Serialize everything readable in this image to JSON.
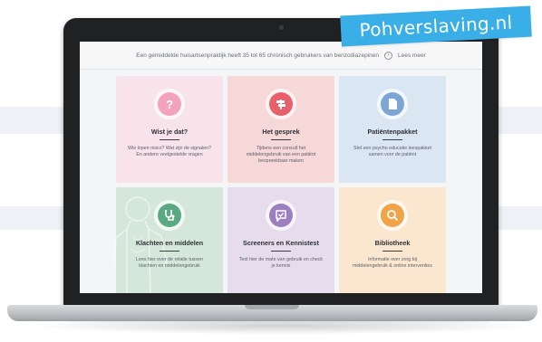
{
  "watermark": {
    "text": "Pohverslaving.nl"
  },
  "topbar": {
    "message": "Een gemiddelde huisartsenpraktijk heeft 35 tot 65 chronisch gebruikers van benzodiazepinen",
    "info_icon": "info-icon",
    "link_label": "Lees meer"
  },
  "cards": [
    {
      "title": "Wist je dat?",
      "description": "Wie lopen risico? Wat zijn de signalen? En andere veelgestelde vragen",
      "icon": "question-icon",
      "color": "#f4a3bd"
    },
    {
      "title": "Het gesprek",
      "description": "Tijdens een consult het middelengebruik van een patiënt bespreekbaar maken",
      "icon": "signpost-icon",
      "color": "#e8606a"
    },
    {
      "title": "Patiëntenpakket",
      "description": "Stel een psycho educatie leespakket samen voor de patiënt",
      "icon": "document-icon",
      "color": "#7ca6d6"
    },
    {
      "title": "Klachten en middelen",
      "description": "Lees hier over de relatie tussen klachten en middelengebruik",
      "icon": "stethoscope-icon",
      "color": "#5aa982"
    },
    {
      "title": "Screeners en Kennistest",
      "description": "Test hier de mate van gebruik en check je kennis",
      "icon": "chat-check-icon",
      "color": "#9c7fbf"
    },
    {
      "title": "Bibliotheek",
      "description": "Informatie over zorg bij middelengebruik & online interventies",
      "icon": "search-icon",
      "color": "#f0a447"
    }
  ]
}
